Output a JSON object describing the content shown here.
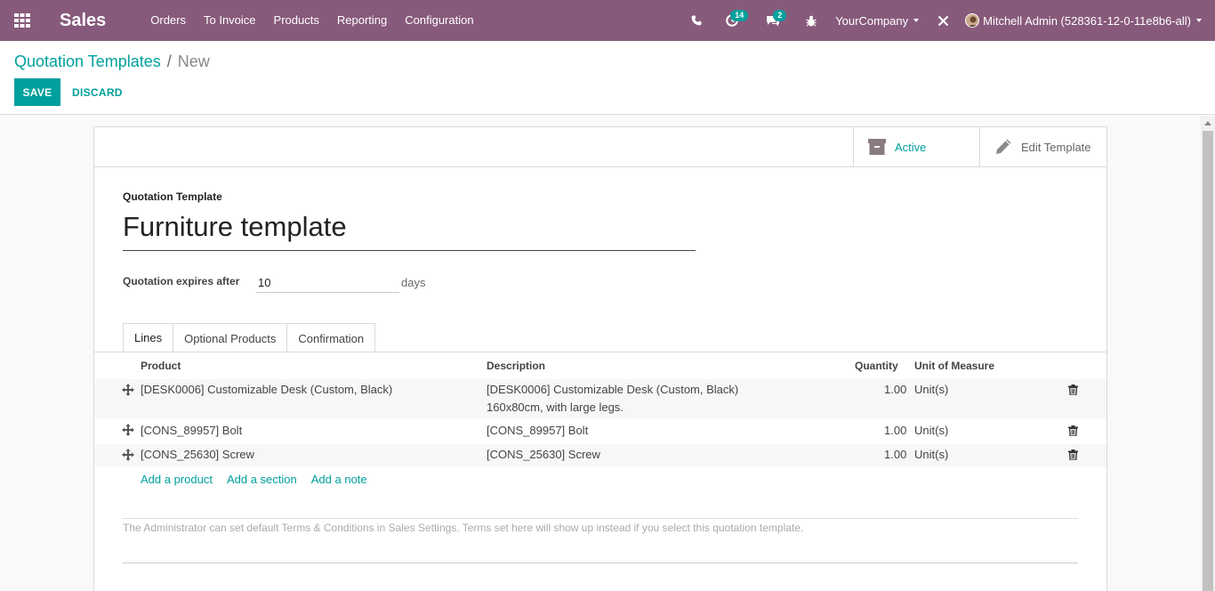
{
  "navbar": {
    "brand": "Sales",
    "menu": [
      "Orders",
      "To Invoice",
      "Products",
      "Reporting",
      "Configuration"
    ],
    "activity_count": "14",
    "message_count": "2",
    "company": "YourCompany",
    "user": "Mitchell Admin (528361-12-0-11e8b6-all)"
  },
  "breadcrumb": {
    "parent": "Quotation Templates",
    "separator": "/",
    "current": "New"
  },
  "actions": {
    "save": "SAVE",
    "discard": "DISCARD"
  },
  "button_box": {
    "active": "Active",
    "edit_template": "Edit Template"
  },
  "form": {
    "name_label": "Quotation Template",
    "name_value": "Furniture template",
    "expires_label": "Quotation expires after",
    "expires_value": "10",
    "expires_unit": "days"
  },
  "tabs": [
    "Lines",
    "Optional Products",
    "Confirmation"
  ],
  "lines": {
    "headers": {
      "product": "Product",
      "description": "Description",
      "quantity": "Quantity",
      "uom": "Unit of Measure"
    },
    "rows": [
      {
        "product": "[DESK0006] Customizable Desk (Custom, Black)",
        "description": "[DESK0006] Customizable Desk (Custom, Black)",
        "description2": "160x80cm, with large legs.",
        "quantity": "1.00",
        "uom": "Unit(s)"
      },
      {
        "product": "[CONS_89957] Bolt",
        "description": "[CONS_89957] Bolt",
        "quantity": "1.00",
        "uom": "Unit(s)"
      },
      {
        "product": "[CONS_25630] Screw",
        "description": "[CONS_25630] Screw",
        "quantity": "1.00",
        "uom": "Unit(s)"
      }
    ],
    "add_product": "Add a product",
    "add_section": "Add a section",
    "add_note": "Add a note"
  },
  "terms_placeholder": "The Administrator can set default Terms & Conditions in Sales Settings. Terms set here will show up instead if you select this quotation template.",
  "colors": {
    "navbar": "#875a7b",
    "accent": "#00a09d"
  }
}
